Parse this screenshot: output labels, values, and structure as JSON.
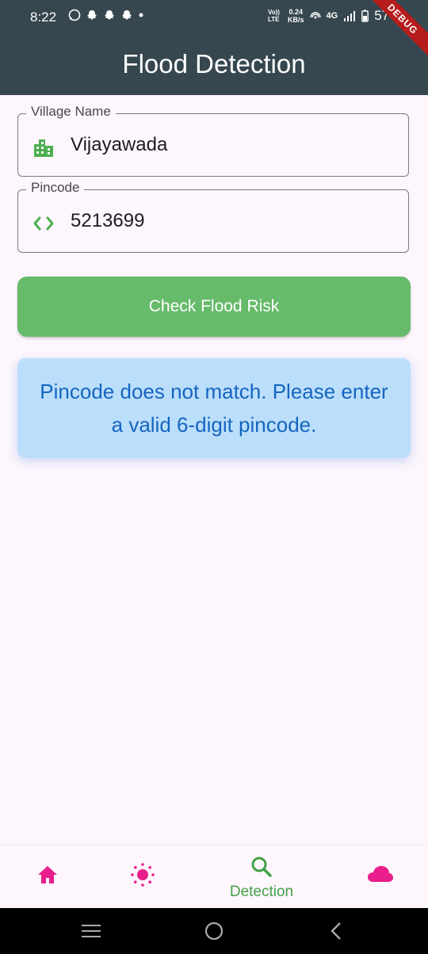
{
  "status_bar": {
    "time": "8:22",
    "net_speed_top": "0.24",
    "net_speed_unit": "KB/s",
    "volte": "Vo)) LTE",
    "network": "4G",
    "battery": "57"
  },
  "debug_banner": "DEBUG",
  "app_bar": {
    "title": "Flood Detection"
  },
  "form": {
    "village": {
      "label": "Village Name",
      "value": "Vijayawada",
      "icon": "location-city-icon"
    },
    "pincode": {
      "label": "Pincode",
      "value": "5213699",
      "icon": "code-icon"
    }
  },
  "check_button": {
    "label": "Check Flood Risk"
  },
  "result_message": "Pincode does not match. Please enter a valid 6-digit pincode.",
  "bottom_nav": {
    "items": [
      {
        "icon": "home-icon",
        "label": ""
      },
      {
        "icon": "sun-icon",
        "label": ""
      },
      {
        "icon": "search-icon",
        "label": "Detection",
        "active": true
      },
      {
        "icon": "cloud-icon",
        "label": ""
      }
    ]
  },
  "colors": {
    "app_bar": "#37474f",
    "accent_green": "#66bb6a",
    "nav_pink": "#e91e8c",
    "message_bg": "#bbdefb",
    "message_text": "#1565c0"
  }
}
